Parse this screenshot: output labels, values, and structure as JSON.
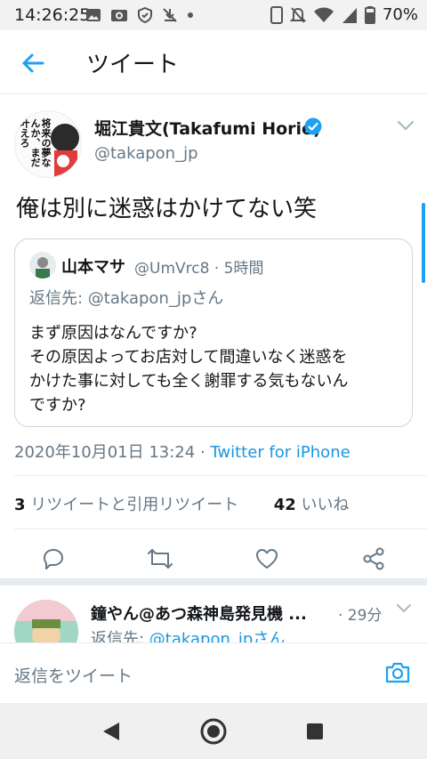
{
  "status_bar": {
    "time": "14:26:25",
    "battery": "70%"
  },
  "header": {
    "title": "ツイート"
  },
  "tweet": {
    "author_name": "堀江貴文(Takafumi Horie)",
    "author_handle": "@takapon_jp",
    "avatar_text": "将来の夢なんか、まだ叶えろ",
    "text": "俺は別に迷惑はかけてない笑",
    "timestamp": "2020年10月01日 13:24",
    "separator": " · ",
    "source": "Twitter for iPhone",
    "retweet_count": "3",
    "retweet_label": " リツイートと引用リツイート",
    "like_count": "42",
    "like_label": " いいね"
  },
  "quote": {
    "name": "山本マサ",
    "handle_time": "@UmVrc8 · 5時間",
    "reply_to": "返信先: @takapon_jpさん",
    "text_lines": [
      "まず原因はなんですか?",
      "その原因よってお店対して間違いなく迷惑を",
      "かけた事に対しても全く謝罪する気もないん",
      "ですか?"
    ]
  },
  "reply": {
    "name": "鐘やん@あつ森神島発見機 ...",
    "time": "· 29分",
    "reply_prefix": "返信先: ",
    "reply_handle": "@takapon_jpさん"
  },
  "composer": {
    "placeholder": "返信をツイート"
  },
  "colors": {
    "accent": "#1da1f2",
    "link": "#1b95e0",
    "secondary_text": "#657786"
  }
}
